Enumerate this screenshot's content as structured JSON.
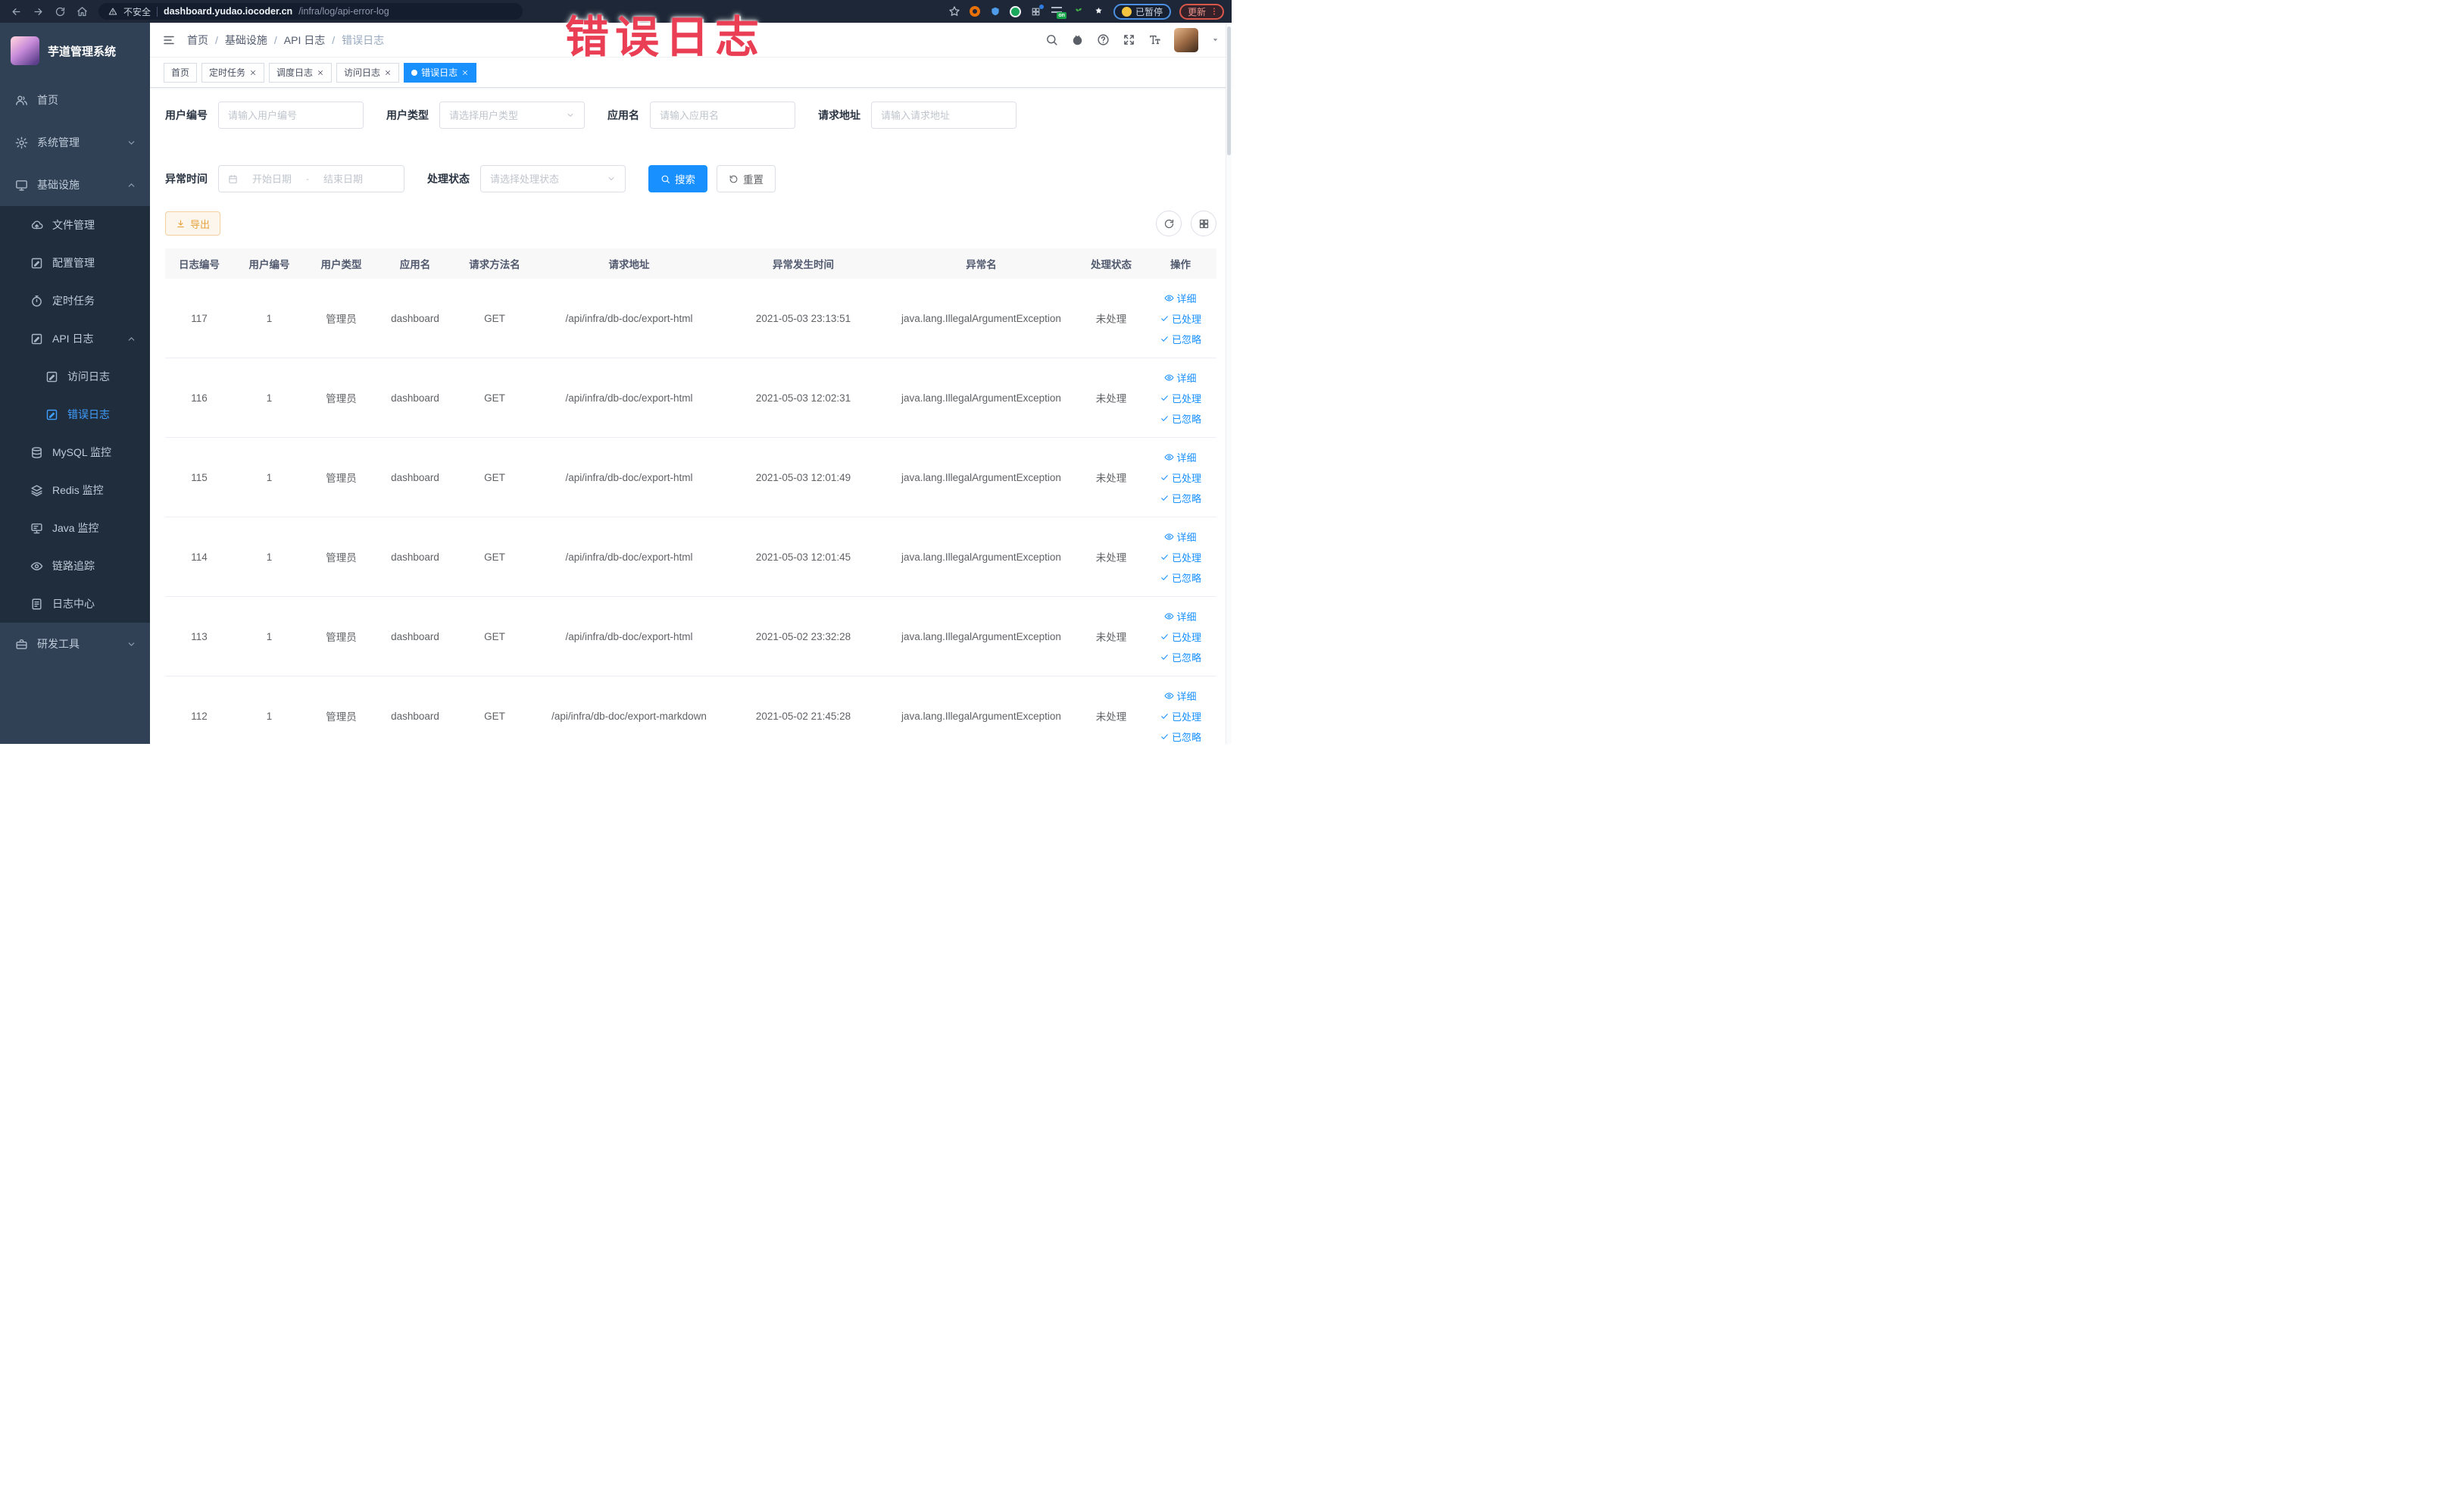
{
  "colors": {
    "accent": "#1890ff",
    "menu_active": "#409eff",
    "watermark_red": "#ea3e54",
    "export_warning": "#e6a23c",
    "sidebar_bg": "#304156",
    "submenu_bg": "#1f2d3d"
  },
  "watermark": "错误日志",
  "browser": {
    "security_label": "不安全",
    "url_host": "dashboard.yudao.iocoder.cn",
    "url_path": "/infra/log/api-error-log",
    "ext_badge": "on",
    "paused_label": "已暂停",
    "update_label": "更新"
  },
  "sidebar": {
    "title": "芋道管理系统",
    "menu": [
      {
        "key": "home",
        "label": "首页",
        "icon": "people",
        "level": "top"
      },
      {
        "key": "system",
        "label": "系统管理",
        "icon": "gear",
        "level": "top",
        "arrow": "down"
      },
      {
        "key": "infra",
        "label": "基础设施",
        "icon": "monitor",
        "level": "top",
        "arrow": "up"
      },
      {
        "key": "file",
        "label": "文件管理",
        "icon": "cloud",
        "level": "sub"
      },
      {
        "key": "config",
        "label": "配置管理",
        "icon": "docedit",
        "level": "sub"
      },
      {
        "key": "job",
        "label": "定时任务",
        "icon": "timer",
        "level": "sub"
      },
      {
        "key": "api-log",
        "label": "API 日志",
        "icon": "docedit",
        "level": "sub",
        "arrow": "up"
      },
      {
        "key": "access-log",
        "label": "访问日志",
        "icon": "docedit",
        "level": "sub2"
      },
      {
        "key": "error-log",
        "label": "错误日志",
        "icon": "docedit",
        "level": "sub2",
        "active": true
      },
      {
        "key": "mysql",
        "label": "MySQL 监控",
        "icon": "db",
        "level": "sub"
      },
      {
        "key": "redis",
        "label": "Redis 监控",
        "icon": "layers",
        "level": "sub"
      },
      {
        "key": "java",
        "label": "Java 监控",
        "icon": "java",
        "level": "sub"
      },
      {
        "key": "trace",
        "label": "链路追踪",
        "icon": "eye",
        "level": "sub"
      },
      {
        "key": "log-center",
        "label": "日志中心",
        "icon": "doc",
        "level": "sub"
      },
      {
        "key": "dev-tool",
        "label": "研发工具",
        "icon": "toolbox",
        "level": "top",
        "arrow": "down"
      }
    ]
  },
  "breadcrumb": [
    "首页",
    "基础设施",
    "API 日志",
    "错误日志"
  ],
  "tabs": [
    {
      "key": "home",
      "label": "首页"
    },
    {
      "key": "job",
      "label": "定时任务",
      "closable": true
    },
    {
      "key": "job-log",
      "label": "调度日志",
      "closable": true
    },
    {
      "key": "access-log",
      "label": "访问日志",
      "closable": true
    },
    {
      "key": "error-log",
      "label": "错误日志",
      "closable": true,
      "active": true
    }
  ],
  "filters": {
    "user_id": {
      "label": "用户编号",
      "placeholder": "请输入用户编号"
    },
    "user_type": {
      "label": "用户类型",
      "placeholder": "请选择用户类型"
    },
    "app_name": {
      "label": "应用名",
      "placeholder": "请输入应用名"
    },
    "request_url": {
      "label": "请求地址",
      "placeholder": "请输入请求地址"
    },
    "exception_time": {
      "label": "异常时间",
      "start_placeholder": "开始日期",
      "separator": "-",
      "end_placeholder": "结束日期"
    },
    "process_status": {
      "label": "处理状态",
      "placeholder": "请选择处理状态"
    },
    "search_label": "搜索",
    "reset_label": "重置"
  },
  "toolbar": {
    "export_label": "导出"
  },
  "table": {
    "columns": [
      "日志编号",
      "用户编号",
      "用户类型",
      "应用名",
      "请求方法名",
      "请求地址",
      "异常发生时间",
      "异常名",
      "处理状态",
      "操作"
    ],
    "row_actions": [
      "详细",
      "已处理",
      "已忽略"
    ],
    "rows": [
      {
        "id": "117",
        "user_id": "1",
        "user_type": "管理员",
        "app_name": "dashboard",
        "method": "GET",
        "url": "/api/infra/db-doc/export-html",
        "time": "2021-05-03 23:13:51",
        "exception": "java.lang.IllegalArgumentException",
        "status": "未处理"
      },
      {
        "id": "116",
        "user_id": "1",
        "user_type": "管理员",
        "app_name": "dashboard",
        "method": "GET",
        "url": "/api/infra/db-doc/export-html",
        "time": "2021-05-03 12:02:31",
        "exception": "java.lang.IllegalArgumentException",
        "status": "未处理"
      },
      {
        "id": "115",
        "user_id": "1",
        "user_type": "管理员",
        "app_name": "dashboard",
        "method": "GET",
        "url": "/api/infra/db-doc/export-html",
        "time": "2021-05-03 12:01:49",
        "exception": "java.lang.IllegalArgumentException",
        "status": "未处理"
      },
      {
        "id": "114",
        "user_id": "1",
        "user_type": "管理员",
        "app_name": "dashboard",
        "method": "GET",
        "url": "/api/infra/db-doc/export-html",
        "time": "2021-05-03 12:01:45",
        "exception": "java.lang.IllegalArgumentException",
        "status": "未处理"
      },
      {
        "id": "113",
        "user_id": "1",
        "user_type": "管理员",
        "app_name": "dashboard",
        "method": "GET",
        "url": "/api/infra/db-doc/export-html",
        "time": "2021-05-02 23:32:28",
        "exception": "java.lang.IllegalArgumentException",
        "status": "未处理"
      },
      {
        "id": "112",
        "user_id": "1",
        "user_type": "管理员",
        "app_name": "dashboard",
        "method": "GET",
        "url": "/api/infra/db-doc/export-markdown",
        "time": "2021-05-02 21:45:28",
        "exception": "java.lang.IllegalArgumentException",
        "status": "未处理"
      }
    ]
  }
}
